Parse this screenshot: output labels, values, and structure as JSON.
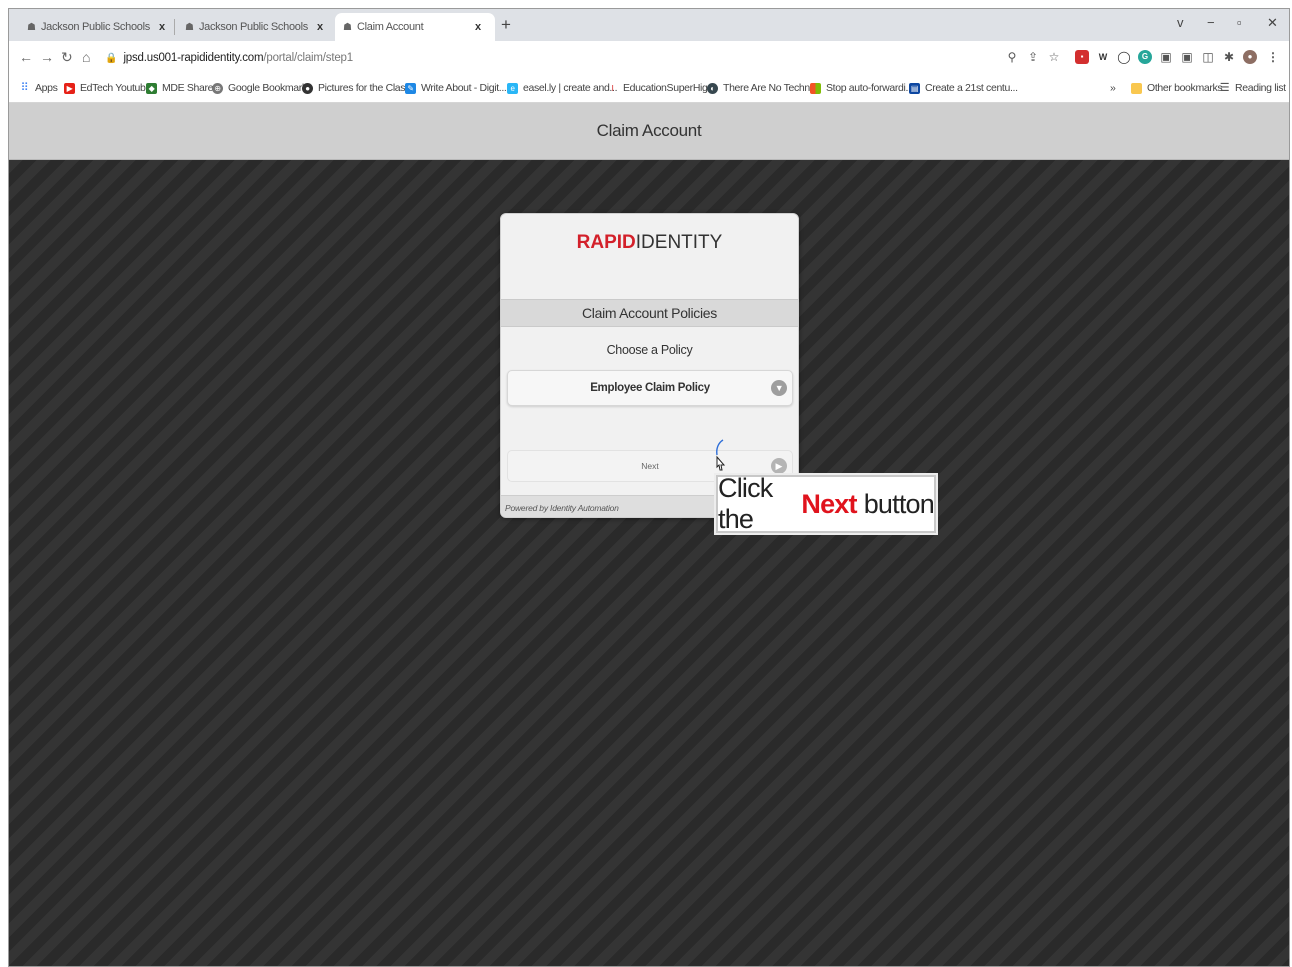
{
  "browser": {
    "tabs": [
      {
        "title": "Jackson Public Schools Portal",
        "close": "x",
        "active": false
      },
      {
        "title": "Jackson Public Schools Portal",
        "close": "x",
        "active": false
      },
      {
        "title": "Claim Account",
        "close": "x",
        "active": true
      }
    ],
    "new_tab": "+",
    "window_controls": {
      "tab_search": "v",
      "minimize": "−",
      "restore": "▫",
      "close": "✕"
    },
    "url_host": "jpsd.us001-rapididentity.com",
    "url_path": "/portal/claim/step1",
    "bookmarks": [
      {
        "label": "Apps",
        "icon": "apps-grid-icon",
        "color": "#4285f4"
      },
      {
        "label": "EdTech Youtube",
        "icon": "youtube-icon",
        "color": "#e62117"
      },
      {
        "label": "MDE Share",
        "icon": "mde-share-icon",
        "color": "#2e7d32"
      },
      {
        "label": "Google Bookmark",
        "icon": "google-bookmark-icon",
        "color": "#777777"
      },
      {
        "label": "Pictures for the Clas...",
        "icon": "pictures-icon",
        "color": "#333333"
      },
      {
        "label": "Write About - Digit...",
        "icon": "write-about-icon",
        "color": "#1e88e5"
      },
      {
        "label": "easel.ly | create and...",
        "icon": "easelly-icon",
        "color": "#29b6f6"
      },
      {
        "label": "EducationSuperHig...",
        "icon": "education-superhighway-icon",
        "color": "#d32f2f"
      },
      {
        "label": "There Are No Techn...",
        "icon": "there-are-no-tech-icon",
        "color": "#37474f"
      },
      {
        "label": "Stop auto-forwardi...",
        "icon": "microsoft-icon",
        "color": "#f35325"
      },
      {
        "label": "Create a 21st centu...",
        "icon": "create-21st-century-icon",
        "color": "#0d47a1"
      }
    ],
    "overflow": "»",
    "other_bookmarks": "Other bookmarks",
    "reading_list": "Reading list"
  },
  "page": {
    "header_title": "Claim Account",
    "logo_rapid": "RAPID",
    "logo_identity": "IDENTITY",
    "policies_title": "Claim Account Policies",
    "choose_label": "Choose a Policy",
    "policy_selected": "Employee Claim Policy",
    "next_label": "Next",
    "footer": "Powered by Identity Automation"
  },
  "tooltip": {
    "prefix": "Click the",
    "emphasis": "Next",
    "suffix": "button"
  },
  "colors": {
    "brand_red": "#d3202a",
    "tooltip_red": "#e0131d"
  }
}
